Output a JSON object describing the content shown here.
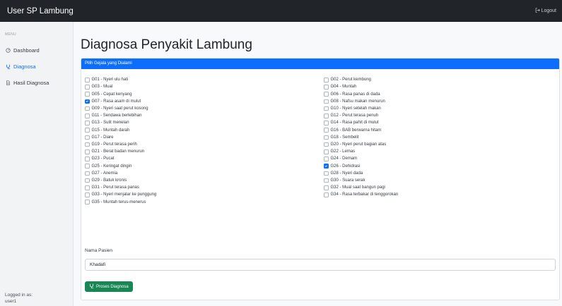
{
  "app": {
    "title": "User SP Lambung",
    "logout_label": "Logout"
  },
  "sidebar": {
    "menu_heading": "MENU",
    "items": [
      {
        "label": "Dashboard",
        "icon": "dashboard-icon"
      },
      {
        "label": "Diagnosa",
        "icon": "diagnosa-icon",
        "active": true
      },
      {
        "label": "Hasil Diagnosa",
        "icon": "document-icon"
      }
    ],
    "logged_in_label": "Logged in as:",
    "username": "user1"
  },
  "main": {
    "title": "Diagnosa Penyakit Lambung",
    "card_header": "Pilih Gejala yang Dialami",
    "symptoms": [
      {
        "label": "G01 - Nyeri ulu hati",
        "checked": false
      },
      {
        "label": "G02 - Perut kembung",
        "checked": false
      },
      {
        "label": "G03 - Mual",
        "checked": false
      },
      {
        "label": "G04 - Muntah",
        "checked": false
      },
      {
        "label": "G05 - Cepat kenyang",
        "checked": false
      },
      {
        "label": "G06 - Rasa panas di dada",
        "checked": false
      },
      {
        "label": "G07 - Rasa asam di mulut",
        "checked": true
      },
      {
        "label": "G08 - Nafsu makan menurun",
        "checked": false
      },
      {
        "label": "G09 - Nyeri saat perut kosong",
        "checked": false
      },
      {
        "label": "G10 - Nyeri setelah makan",
        "checked": false
      },
      {
        "label": "G11 - Sendawa berlebihan",
        "checked": false
      },
      {
        "label": "G12 - Perut terasa penuh",
        "checked": false
      },
      {
        "label": "G13 - Sulit menelan",
        "checked": false
      },
      {
        "label": "G14 - Rasa pahit di mulut",
        "checked": false
      },
      {
        "label": "G15 - Muntah darah",
        "checked": false
      },
      {
        "label": "G16 - BAB berwarna hitam",
        "checked": false
      },
      {
        "label": "G17 - Diare",
        "checked": false
      },
      {
        "label": "G18 - Sembelit",
        "checked": false
      },
      {
        "label": "G19 - Perut terasa perih",
        "checked": false
      },
      {
        "label": "G20 - Nyeri perut bagian atas",
        "checked": false
      },
      {
        "label": "G21 - Berat badan menurun",
        "checked": false
      },
      {
        "label": "G22 - Lemas",
        "checked": false
      },
      {
        "label": "G23 - Pucat",
        "checked": false
      },
      {
        "label": "G24 - Demam",
        "checked": false
      },
      {
        "label": "G25 - Keringat dingin",
        "checked": false
      },
      {
        "label": "G26 - Dehidrasi",
        "checked": true
      },
      {
        "label": "G27 - Anemia",
        "checked": false
      },
      {
        "label": "G28 - Nyeri dada",
        "checked": false
      },
      {
        "label": "G29 - Batuk kronis",
        "checked": false
      },
      {
        "label": "G30 - Suara serak",
        "checked": false
      },
      {
        "label": "G31 - Perut terasa panas",
        "checked": false
      },
      {
        "label": "G32 - Mual saat bangun pagi",
        "checked": false
      },
      {
        "label": "G33 - Nyeri menjalar ke punggung",
        "checked": false
      },
      {
        "label": "G34 - Rasa terbakar di tenggorokan",
        "checked": false
      },
      {
        "label": "G35 - Muntah terus-menerus",
        "checked": false
      }
    ],
    "patient_name_label": "Nama Pasien",
    "patient_name_value": "Khadafi",
    "submit_label": "Proses Diagnosa"
  },
  "colors": {
    "topbar": "#212529",
    "primary": "#0d6efd",
    "success": "#198754"
  }
}
